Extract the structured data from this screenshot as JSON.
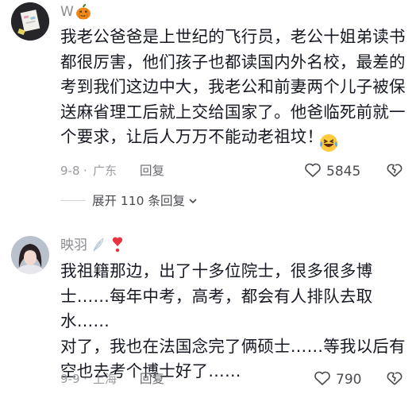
{
  "comments": [
    {
      "username": "W",
      "username_emoji": "pumpkin-icon",
      "text": "我老公爸爸是上世纪的飞行员，老公十姐弟读书\n都很厉害，他们孩子也都读国内外名校，最差的\n考到我们这边中大，我老公和前妻两个儿子被保\n送麻省理工后就上交给国家了。他爸临死前就一\n个要求，让后人万万不能动老祖坟！",
      "date": "9-8",
      "location": "广东",
      "reply_label": "回复",
      "likes": "5845",
      "expand_label": "展开 110 条回复"
    },
    {
      "username": "映羽",
      "username_emoji": "feather-heart-icon",
      "text": "我祖籍那边，出了十多位院士，很多很多博\n士……每年中考，高考，都会有人排队去取水……\n对了，我也在法国念完了俩硕士……等我以后有\n空也去考个博士好了……",
      "date": "9-9",
      "location": "上海",
      "reply_label": "回复",
      "likes": "790"
    }
  ],
  "colors": {
    "text": "#161823",
    "muted": "#9a9ba0",
    "username": "#8a8b91",
    "accent_heart": "#e5333f"
  }
}
